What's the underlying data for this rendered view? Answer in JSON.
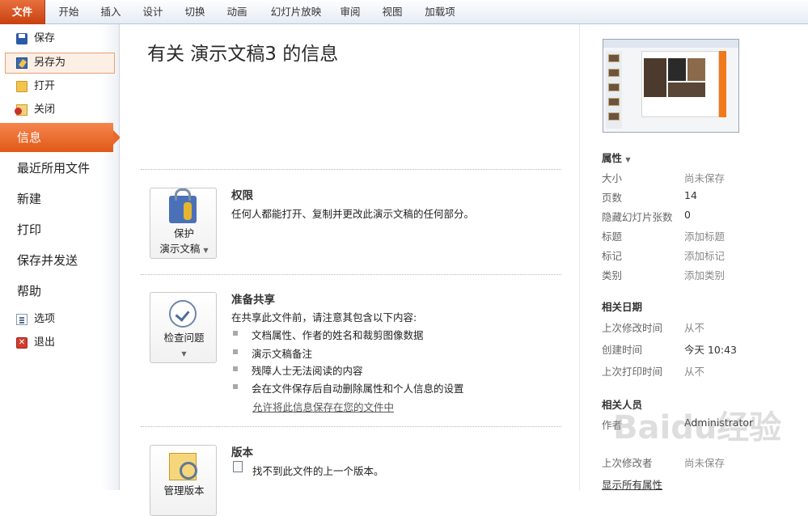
{
  "ribbon": {
    "tabs": [
      "文件",
      "开始",
      "插入",
      "设计",
      "切换",
      "动画",
      "幻灯片放映",
      "审阅",
      "视图",
      "加载项"
    ]
  },
  "backstage": {
    "commands": {
      "save": "保存",
      "save_as": "另存为",
      "open": "打开",
      "close": "关闭"
    },
    "nav": {
      "info": "信息",
      "recent": "最近所用文件",
      "new": "新建",
      "print": "打印",
      "save_send": "保存并发送",
      "help": "帮助"
    },
    "options": "选项",
    "exit": "退出"
  },
  "info": {
    "title": "有关 演示文稿3 的信息",
    "permissions": {
      "button_line1": "保护",
      "button_line2": "演示文稿",
      "heading": "权限",
      "text": "任何人都能打开、复制并更改此演示文稿的任何部分。"
    },
    "prepare": {
      "button_line1": "检查问题",
      "heading": "准备共享",
      "intro": "在共享此文件前，请注意其包含以下内容:",
      "bullets": [
        "文档属性、作者的姓名和裁剪图像数据",
        "演示文稿备注",
        "残障人士无法阅读的内容",
        "会在文件保存后自动删除属性和个人信息的设置"
      ],
      "link": "允许将此信息保存在您的文件中"
    },
    "versions": {
      "button_line1": "管理版本",
      "heading": "版本",
      "text": "找不到此文件的上一个版本。"
    }
  },
  "properties": {
    "heading": "属性",
    "rows": [
      {
        "key": "大小",
        "value": "尚未保存"
      },
      {
        "key": "页数",
        "value": "14"
      },
      {
        "key": "隐藏幻灯片张数",
        "value": "0"
      },
      {
        "key": "标题",
        "value": "添加标题"
      },
      {
        "key": "标记",
        "value": "添加标记"
      },
      {
        "key": "类别",
        "value": "添加类别"
      }
    ],
    "dates_heading": "相关日期",
    "dates": [
      {
        "key": "上次修改时间",
        "value": "从不"
      },
      {
        "key": "创建时间",
        "value": "今天 10:43"
      },
      {
        "key": "上次打印时间",
        "value": "从不"
      }
    ],
    "people_heading": "相关人员",
    "author_key": "作者",
    "author_value": "Administrator",
    "modified_by_key": "上次修改者",
    "modified_by_value": "尚未保存",
    "show_all": "显示所有属性"
  },
  "watermark": "Baidu经验"
}
